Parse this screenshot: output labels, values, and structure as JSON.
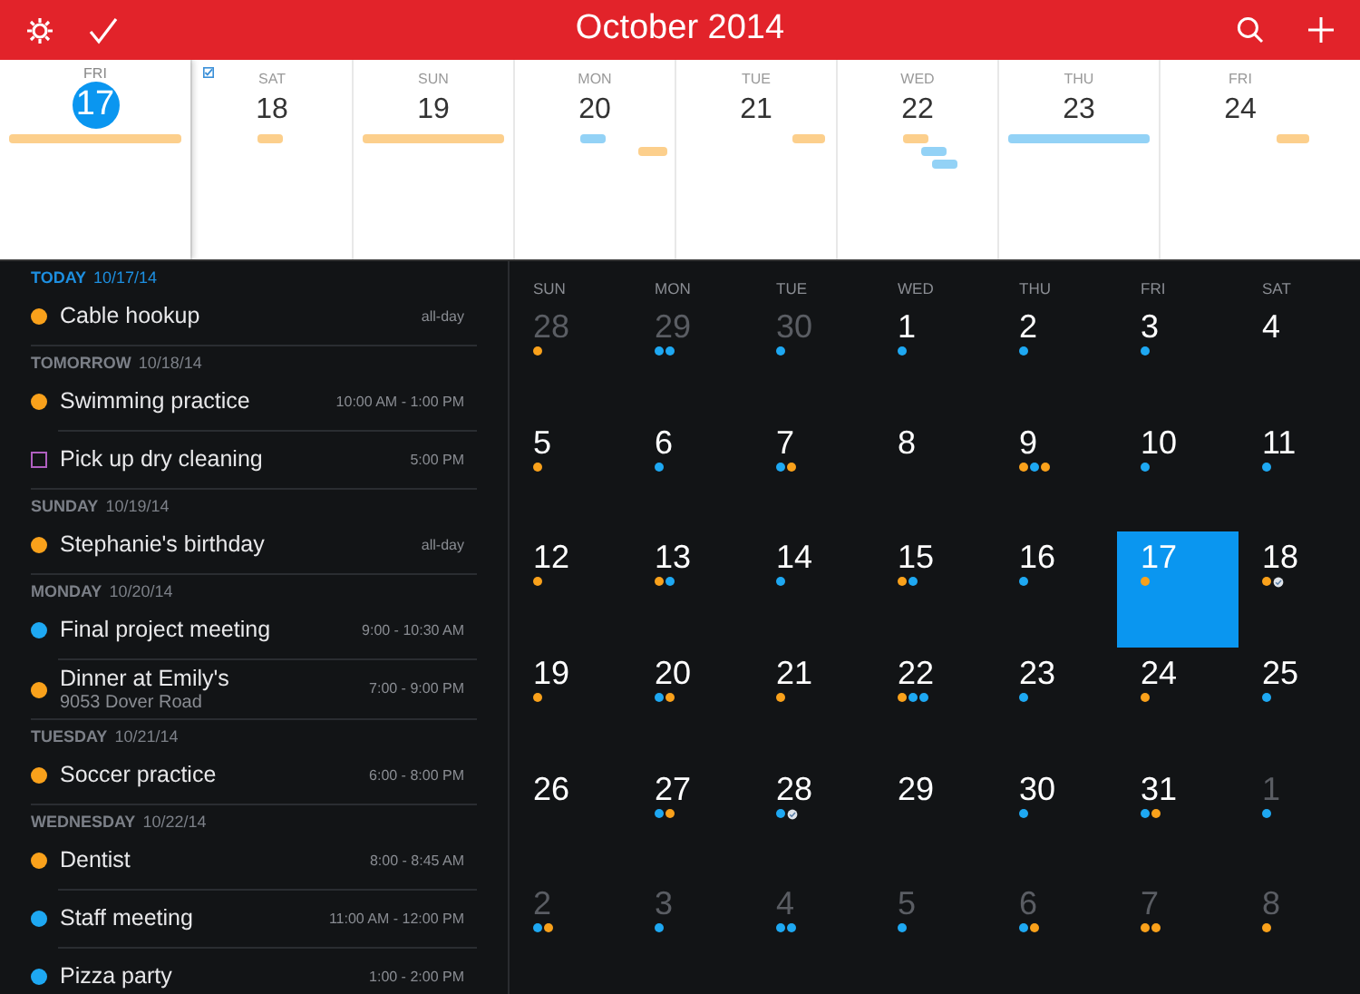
{
  "header": {
    "title": "October 2014"
  },
  "week_strip": [
    {
      "weekday": "FRI",
      "day": "17",
      "selected": true,
      "has_task": false,
      "bars": [
        {
          "kind": "all-day",
          "color": "#fccf8c"
        }
      ]
    },
    {
      "weekday": "SAT",
      "day": "18",
      "selected": false,
      "has_task": true,
      "bars": [
        {
          "kind": "timed",
          "color": "#fccf8c"
        }
      ]
    },
    {
      "weekday": "SUN",
      "day": "19",
      "selected": false,
      "has_task": false,
      "bars": [
        {
          "kind": "all-day",
          "color": "#fccf8c"
        }
      ]
    },
    {
      "weekday": "MON",
      "day": "20",
      "selected": false,
      "has_task": false,
      "bars": [
        {
          "kind": "timed",
          "color": "#93d2f6"
        },
        {
          "kind": "timed",
          "color": "#fccf8c"
        }
      ]
    },
    {
      "weekday": "TUE",
      "day": "21",
      "selected": false,
      "has_task": false,
      "bars": [
        {
          "kind": "timed",
          "color": "#fccf8c"
        }
      ]
    },
    {
      "weekday": "WED",
      "day": "22",
      "selected": false,
      "has_task": false,
      "bars": [
        {
          "kind": "timed",
          "color": "#fccf8c"
        },
        {
          "kind": "timed",
          "color": "#93d2f6"
        },
        {
          "kind": "timed",
          "color": "#93d2f6"
        }
      ]
    },
    {
      "weekday": "THU",
      "day": "23",
      "selected": false,
      "has_task": false,
      "bars": [
        {
          "kind": "all-day",
          "color": "#93d2f6"
        }
      ]
    },
    {
      "weekday": "FRI",
      "day": "24",
      "selected": false,
      "has_task": false,
      "bars": [
        {
          "kind": "timed",
          "color": "#fccf8c"
        }
      ]
    }
  ],
  "agenda": [
    {
      "label": "TODAY",
      "date": "10/17/14",
      "today": true,
      "items": [
        {
          "kind": "event",
          "color": "#f9a11b",
          "title": "Cable hookup",
          "time": "all-day"
        }
      ]
    },
    {
      "label": "TOMORROW",
      "date": "10/18/14",
      "today": false,
      "items": [
        {
          "kind": "event",
          "color": "#f9a11b",
          "title": "Swimming practice",
          "time": "10:00 AM - 1:00 PM"
        },
        {
          "kind": "task",
          "color": "#b05fc0",
          "title": "Pick up dry cleaning",
          "time": "5:00 PM"
        }
      ]
    },
    {
      "label": "SUNDAY",
      "date": "10/19/14",
      "today": false,
      "items": [
        {
          "kind": "event",
          "color": "#f9a11b",
          "title": "Stephanie's birthday",
          "time": "all-day"
        }
      ]
    },
    {
      "label": "MONDAY",
      "date": "10/20/14",
      "today": false,
      "items": [
        {
          "kind": "event",
          "color": "#1ea8f2",
          "title": "Final project meeting",
          "time": "9:00 - 10:30 AM"
        },
        {
          "kind": "event",
          "color": "#f9a11b",
          "title": "Dinner at Emily's",
          "subtitle": "9053 Dover Road",
          "time": "7:00 - 9:00 PM"
        }
      ]
    },
    {
      "label": "TUESDAY",
      "date": "10/21/14",
      "today": false,
      "items": [
        {
          "kind": "event",
          "color": "#f9a11b",
          "title": "Soccer practice",
          "time": "6:00 - 8:00 PM"
        }
      ]
    },
    {
      "label": "WEDNESDAY",
      "date": "10/22/14",
      "today": false,
      "items": [
        {
          "kind": "event",
          "color": "#f9a11b",
          "title": "Dentist",
          "time": "8:00 - 8:45 AM"
        },
        {
          "kind": "event",
          "color": "#1ea8f2",
          "title": "Staff meeting",
          "time": "11:00 AM - 12:00 PM"
        },
        {
          "kind": "event",
          "color": "#1ea8f2",
          "title": "Pizza party",
          "time": "1:00 - 2:00 PM"
        }
      ]
    }
  ],
  "month": {
    "weekdays": [
      "SUN",
      "MON",
      "TUE",
      "WED",
      "THU",
      "FRI",
      "SAT"
    ],
    "weeks": [
      [
        {
          "day": "28",
          "in_month": false,
          "selected": false,
          "dots": [
            {
              "kind": "event",
              "color": "#f9a11b"
            }
          ]
        },
        {
          "day": "29",
          "in_month": false,
          "selected": false,
          "dots": [
            {
              "kind": "event",
              "color": "#1ea8f2"
            },
            {
              "kind": "event",
              "color": "#1ea8f2"
            }
          ]
        },
        {
          "day": "30",
          "in_month": false,
          "selected": false,
          "dots": [
            {
              "kind": "event",
              "color": "#1ea8f2"
            }
          ]
        },
        {
          "day": "1",
          "in_month": true,
          "selected": false,
          "dots": [
            {
              "kind": "event",
              "color": "#1ea8f2"
            }
          ]
        },
        {
          "day": "2",
          "in_month": true,
          "selected": false,
          "dots": [
            {
              "kind": "event",
              "color": "#1ea8f2"
            }
          ]
        },
        {
          "day": "3",
          "in_month": true,
          "selected": false,
          "dots": [
            {
              "kind": "event",
              "color": "#1ea8f2"
            }
          ]
        },
        {
          "day": "4",
          "in_month": true,
          "selected": false
        }
      ],
      [
        {
          "day": "5",
          "in_month": true,
          "selected": false,
          "dots": [
            {
              "kind": "event",
              "color": "#f9a11b"
            }
          ]
        },
        {
          "day": "6",
          "in_month": true,
          "selected": false,
          "dots": [
            {
              "kind": "event",
              "color": "#1ea8f2"
            }
          ]
        },
        {
          "day": "7",
          "in_month": true,
          "selected": false,
          "dots": [
            {
              "kind": "event",
              "color": "#1ea8f2"
            },
            {
              "kind": "event",
              "color": "#f9a11b"
            }
          ]
        },
        {
          "day": "8",
          "in_month": true,
          "selected": false
        },
        {
          "day": "9",
          "in_month": true,
          "selected": false,
          "dots": [
            {
              "kind": "event",
              "color": "#f9a11b"
            },
            {
              "kind": "event",
              "color": "#1ea8f2"
            },
            {
              "kind": "event",
              "color": "#f9a11b"
            }
          ]
        },
        {
          "day": "10",
          "in_month": true,
          "selected": false,
          "dots": [
            {
              "kind": "event",
              "color": "#1ea8f2"
            }
          ]
        },
        {
          "day": "11",
          "in_month": true,
          "selected": false,
          "dots": [
            {
              "kind": "event",
              "color": "#1ea8f2"
            }
          ]
        }
      ],
      [
        {
          "day": "12",
          "in_month": true,
          "selected": false,
          "dots": [
            {
              "kind": "event",
              "color": "#f9a11b"
            }
          ]
        },
        {
          "day": "13",
          "in_month": true,
          "selected": false,
          "dots": [
            {
              "kind": "event",
              "color": "#f9a11b"
            },
            {
              "kind": "event",
              "color": "#1ea8f2"
            }
          ]
        },
        {
          "day": "14",
          "in_month": true,
          "selected": false,
          "dots": [
            {
              "kind": "event",
              "color": "#1ea8f2"
            }
          ]
        },
        {
          "day": "15",
          "in_month": true,
          "selected": false,
          "dots": [
            {
              "kind": "event",
              "color": "#f9a11b"
            },
            {
              "kind": "event",
              "color": "#1ea8f2"
            }
          ]
        },
        {
          "day": "16",
          "in_month": true,
          "selected": false,
          "dots": [
            {
              "kind": "event",
              "color": "#1ea8f2"
            }
          ]
        },
        {
          "day": "17",
          "in_month": true,
          "selected": true,
          "dots": [
            {
              "kind": "event",
              "color": "#f9a11b"
            }
          ]
        },
        {
          "day": "18",
          "in_month": true,
          "selected": false,
          "dots": [
            {
              "kind": "event",
              "color": "#f9a11b"
            },
            {
              "kind": "task"
            }
          ]
        }
      ],
      [
        {
          "day": "19",
          "in_month": true,
          "selected": false,
          "dots": [
            {
              "kind": "event",
              "color": "#f9a11b"
            }
          ]
        },
        {
          "day": "20",
          "in_month": true,
          "selected": false,
          "dots": [
            {
              "kind": "event",
              "color": "#1ea8f2"
            },
            {
              "kind": "event",
              "color": "#f9a11b"
            }
          ]
        },
        {
          "day": "21",
          "in_month": true,
          "selected": false,
          "dots": [
            {
              "kind": "event",
              "color": "#f9a11b"
            }
          ]
        },
        {
          "day": "22",
          "in_month": true,
          "selected": false,
          "dots": [
            {
              "kind": "event",
              "color": "#f9a11b"
            },
            {
              "kind": "event",
              "color": "#1ea8f2"
            },
            {
              "kind": "event",
              "color": "#1ea8f2"
            }
          ]
        },
        {
          "day": "23",
          "in_month": true,
          "selected": false,
          "dots": [
            {
              "kind": "event",
              "color": "#1ea8f2"
            }
          ]
        },
        {
          "day": "24",
          "in_month": true,
          "selected": false,
          "dots": [
            {
              "kind": "event",
              "color": "#f9a11b"
            }
          ]
        },
        {
          "day": "25",
          "in_month": true,
          "selected": false,
          "dots": [
            {
              "kind": "event",
              "color": "#1ea8f2"
            }
          ]
        }
      ],
      [
        {
          "day": "26",
          "in_month": true,
          "selected": false
        },
        {
          "day": "27",
          "in_month": true,
          "selected": false,
          "dots": [
            {
              "kind": "event",
              "color": "#1ea8f2"
            },
            {
              "kind": "event",
              "color": "#f9a11b"
            }
          ]
        },
        {
          "day": "28",
          "in_month": true,
          "selected": false,
          "dots": [
            {
              "kind": "event",
              "color": "#1ea8f2"
            },
            {
              "kind": "task"
            }
          ]
        },
        {
          "day": "29",
          "in_month": true,
          "selected": false
        },
        {
          "day": "30",
          "in_month": true,
          "selected": false,
          "dots": [
            {
              "kind": "event",
              "color": "#1ea8f2"
            }
          ]
        },
        {
          "day": "31",
          "in_month": true,
          "selected": false,
          "dots": [
            {
              "kind": "event",
              "color": "#1ea8f2"
            },
            {
              "kind": "event",
              "color": "#f9a11b"
            }
          ]
        },
        {
          "day": "1",
          "in_month": false,
          "selected": false,
          "dots": [
            {
              "kind": "event",
              "color": "#1ea8f2"
            }
          ]
        }
      ],
      [
        {
          "day": "2",
          "in_month": false,
          "selected": false,
          "dots": [
            {
              "kind": "event",
              "color": "#1ea8f2"
            },
            {
              "kind": "event",
              "color": "#f9a11b"
            }
          ]
        },
        {
          "day": "3",
          "in_month": false,
          "selected": false,
          "dots": [
            {
              "kind": "event",
              "color": "#1ea8f2"
            }
          ]
        },
        {
          "day": "4",
          "in_month": false,
          "selected": false,
          "dots": [
            {
              "kind": "event",
              "color": "#1ea8f2"
            },
            {
              "kind": "event",
              "color": "#1ea8f2"
            }
          ]
        },
        {
          "day": "5",
          "in_month": false,
          "selected": false,
          "dots": [
            {
              "kind": "event",
              "color": "#1ea8f2"
            }
          ]
        },
        {
          "day": "6",
          "in_month": false,
          "selected": false,
          "dots": [
            {
              "kind": "event",
              "color": "#1ea8f2"
            },
            {
              "kind": "event",
              "color": "#f9a11b"
            }
          ]
        },
        {
          "day": "7",
          "in_month": false,
          "selected": false,
          "dots": [
            {
              "kind": "event",
              "color": "#f9a11b"
            },
            {
              "kind": "event",
              "color": "#f9a11b"
            }
          ]
        },
        {
          "day": "8",
          "in_month": false,
          "selected": false,
          "dots": [
            {
              "kind": "event",
              "color": "#f9a11b"
            }
          ]
        }
      ]
    ]
  }
}
